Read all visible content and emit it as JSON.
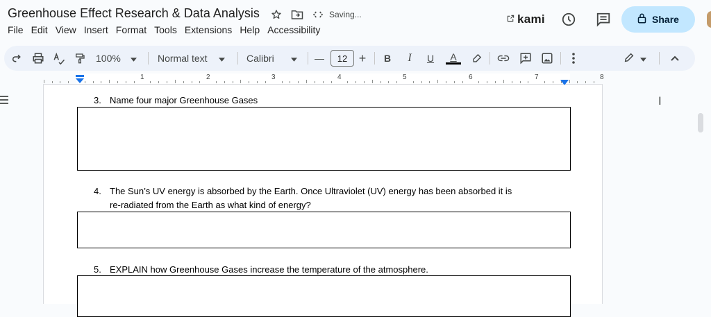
{
  "header": {
    "doc_title": "Greenhouse Effect Research & Data Analysis",
    "saving_status": "Saving...",
    "kami_label": "kami",
    "share_label": "Share"
  },
  "menu": [
    "File",
    "Edit",
    "View",
    "Insert",
    "Format",
    "Tools",
    "Extensions",
    "Help",
    "Accessibility"
  ],
  "toolbar": {
    "zoom": "100%",
    "style": "Normal text",
    "font": "Calibri",
    "font_size": "12",
    "minus": "—",
    "plus": "+",
    "bold": "B",
    "italic": "I",
    "underline": "U",
    "text_color": "A"
  },
  "ruler": {
    "numbers": [
      "1",
      "2",
      "3",
      "4",
      "5",
      "6",
      "7",
      "8"
    ]
  },
  "questions": [
    {
      "num": "3.",
      "text": "Name four major Greenhouse Gases"
    },
    {
      "num": "4.",
      "text_line1": "The Sun’s UV energy is absorbed by the Earth. Once Ultraviolet (UV) energy has been absorbed it is",
      "text_line2": "re-radiated from the Earth as what kind of energy?"
    },
    {
      "num": "5.",
      "text": "EXPLAIN how Greenhouse Gases increase the temperature of the atmosphere."
    }
  ],
  "icons": [
    "star-icon",
    "move-to-folder-icon",
    "saving-sync-icon",
    "external-link-icon",
    "history-icon",
    "comments-icon",
    "lock-icon",
    "redo-icon",
    "print-icon",
    "spellcheck-icon",
    "paint-format-icon",
    "chevron-down-icon",
    "highlighter-icon",
    "link-icon",
    "add-comment-icon",
    "insert-image-icon",
    "more-vert-icon",
    "pencil-icon",
    "chevron-up-icon",
    "menu-icon"
  ],
  "colors": {
    "share_bg": "#c2e7ff",
    "toolbar_bg": "#edf2fa",
    "ruler_marker": "#1a73e8"
  }
}
